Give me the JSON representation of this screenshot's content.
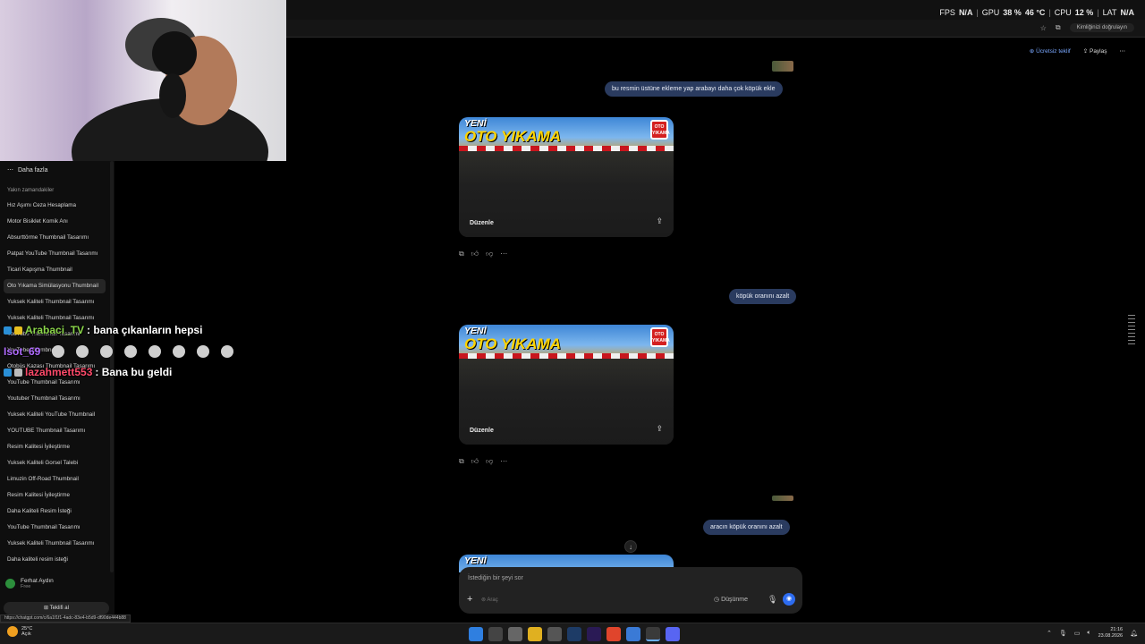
{
  "hud": {
    "fps_label": "FPS",
    "fps_value": "N/A",
    "gpu_label": "GPU",
    "gpu_value": "38 %",
    "gpu_temp": "46 °C",
    "cpu_label": "CPU",
    "cpu_value": "12 %",
    "lat_label": "LAT",
    "lat_value": "N/A",
    "separator": "|"
  },
  "browser": {
    "verify_chip": "Kimliğinizi doğrulayın",
    "star_icon": "star-icon",
    "extension_icon": "puzzle-icon"
  },
  "sidebar": {
    "more_label": "Daha fazla",
    "section_title": "Yakın zamandakiler",
    "items": [
      {
        "label": "Hız Aşımı Ceza Hesaplama"
      },
      {
        "label": "Motor Bisiklet Komik Anı"
      },
      {
        "label": "Absurttörme Thumbnail Tasarımı"
      },
      {
        "label": "Patpat YouTube Thumbnail Tasarımı"
      },
      {
        "label": "Ticari Kapışma Thumbnail"
      },
      {
        "label": "Oto Yıkama Simülasyonu Thumbnail"
      },
      {
        "label": "Yuksek Kaliteli Thumbnail Tasarımı"
      },
      {
        "label": "Yuksek Kaliteli Thumbnail Tasarımı"
      },
      {
        "label": "YouTube Thumbnail Tasarımı"
      },
      {
        "label": "YouTube Thumbnail"
      },
      {
        "label": "Otobüs Kazası Thumbnail Tasarımı"
      },
      {
        "label": "YouTube Thumbnail Tasarımı"
      },
      {
        "label": "Youtuber Thumbnail Tasarımı"
      },
      {
        "label": "Yuksek Kaliteli YouTube Thumbnail"
      },
      {
        "label": "YOUTUBE Thumbnail Tasarımı"
      },
      {
        "label": "Resim Kalitesi İyileştirme"
      },
      {
        "label": "Yuksek Kaliteli Gorsel Talebi"
      },
      {
        "label": "Limuzin Off-Road Thumbnail"
      },
      {
        "label": "Resim Kalitesi İyileştirme"
      },
      {
        "label": "Daha Kaliteli Resim İsteği"
      },
      {
        "label": "YouTube Thumbnail Tasarımı"
      },
      {
        "label": "Yuksek Kaliteli Thumbnail Tasarımı"
      },
      {
        "label": "Daha kaliteli resim isteği"
      }
    ],
    "active_index": 5,
    "user_name": "Ferhat Aydın",
    "user_plan": "Free",
    "teams_button": "Teklifi al",
    "status_url": "https://chatgpt.com/c/6a1f1f1-4adc-83e4-b5d9-df90de444b88"
  },
  "chat_overlay": [
    {
      "user": "Arabaci_TV",
      "color": "#8bd64a",
      "message": ": bana çıkanların hepsi"
    },
    {
      "user": "Isot_69",
      "color": "#b06cff",
      "message": ""
    },
    {
      "user": "lazahmett553",
      "color": "#ff4a6a",
      "message": ": Bana bu geldi"
    }
  ],
  "main": {
    "offer_label": "Ücretsiz teklif",
    "share_label": "Paylaş",
    "messages": [
      {
        "text": "bu resmin üstüne ekleme yap arabayı daha çok köpük ekle"
      },
      {
        "text": "köpük oranını azalt"
      },
      {
        "text": "aracın köpük oranını azalt"
      }
    ],
    "image": {
      "title_line1": "YENİ",
      "title_line2": "OTO YIKAMA",
      "badge_line1": "OTO",
      "badge_line2": "YIKAMA",
      "edit_label": "Düzenle"
    },
    "composer": {
      "placeholder": "İstediğin bir şeyi sor",
      "tool_label": "Araç",
      "thinking_label": "Düşünme"
    }
  },
  "taskbar": {
    "temperature": "25°C",
    "weather": "Açık",
    "time": "21:16",
    "date": "23.08.2026"
  },
  "colors": {
    "bubble": "#2a3b5f",
    "accent_blue": "#2d6cf0",
    "offer_blue": "#7aa8ff"
  }
}
